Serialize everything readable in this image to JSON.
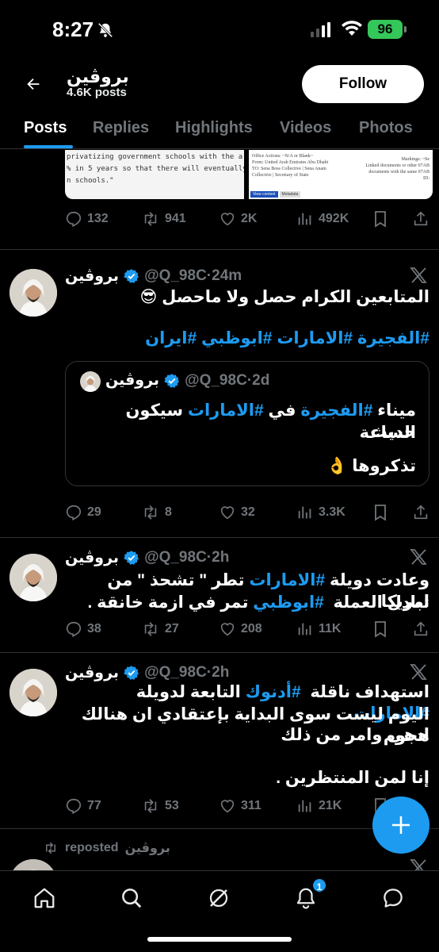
{
  "status_bar": {
    "time": "8:27",
    "battery": "96"
  },
  "header": {
    "name": "بروڤين",
    "posts": "4.6K posts",
    "follow_label": "Follow"
  },
  "tabs": [
    "Posts",
    "Replies",
    "Highlights",
    "Videos",
    "Photos"
  ],
  "partial_tweet": {
    "media_text": [
      "privatizing government schools with the a",
      "% in 5 years so that there will eventually",
      "n schools.\""
    ],
    "doc_text": [
      "Office Actions: ~N/A or Blank~",
      "From: United Arab Emirates Abu Dhabi",
      "TO: Sena Boss Collective | Sena Anam",
      "Collective | Secretary of State",
      "Markings: ~Se",
      "Linked documents or other 07AB",
      "documents with the same 07AB",
      "ID:"
    ],
    "doc_tabs": [
      "View content",
      "Metadata"
    ],
    "replies": "132",
    "reposts": "941",
    "likes": "2K",
    "views": "492K"
  },
  "tweets": [
    {
      "name": "بروڤين",
      "handle": "@Q_98C",
      "time": "·24m",
      "body": "المتابعين الكرام حصل ولا ماحصل 😎",
      "tags": "#الفجيرة #الامارات #ابوظبي #ايران",
      "quote": {
        "name": "بروڤين",
        "handle": "@Q_98C",
        "time": "·2d",
        "line1_a": "ميناء ",
        "line1_tag1": "#الفجيرة",
        "line1_b": " في ",
        "line1_tag2": "#الامارات",
        "line1_c": " سيكون حديث",
        "line2": "الساعة",
        "line3": "تذكروها 👌"
      },
      "replies": "29",
      "reposts": "8",
      "likes": "32",
      "views": "3.3K"
    },
    {
      "name": "بروڤين",
      "handle": "@Q_98C",
      "time": "·2h",
      "line1_a": "وعادت دويلة ",
      "line1_tag": "#الامارات",
      "line1_b": " تطر \" تشحذ \" من امريكا",
      "line2_a": "تبادل العملة  ",
      "line2_tag": "#ابوظبي",
      "line2_b": " تمر في ازمة خانقة .",
      "replies": "38",
      "reposts": "27",
      "likes": "208",
      "views": "11K"
    },
    {
      "name": "بروڤين",
      "handle": "@Q_98C",
      "time": "·2h",
      "line1_a": "استهداف ناقلة  ",
      "line1_tag1": "#أدنوك",
      "line1_b": " التابعة لدويلة ",
      "line1_tag2": "#الامارات",
      "line2": "اليوم ليست سوى البداية بإعتقادي ان هنالك هجوم",
      "line3": "ادهى وامر من ذلك",
      "line4": "إنا لمن المنتظرين .",
      "replies": "77",
      "reposts": "53",
      "likes": "311",
      "views": "21K"
    }
  ],
  "repost_line": {
    "name": "بروڤين",
    "text": "reposted"
  },
  "nav": {
    "notifications_badge": "1"
  }
}
